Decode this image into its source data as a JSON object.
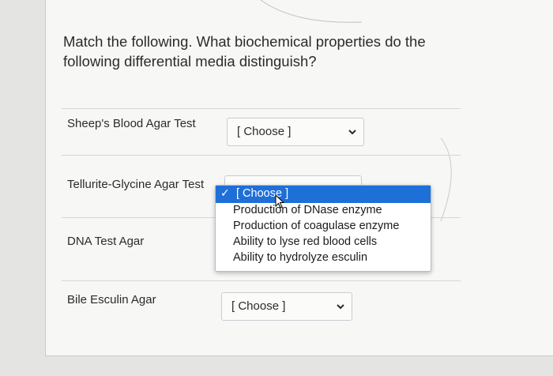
{
  "question": "Match the following. What biochemical properties do the following differential media distinguish?",
  "rows": [
    {
      "label": "Sheep's Blood Agar Test",
      "value": "[ Choose ]"
    },
    {
      "label": "Tellurite-Glycine Agar Test",
      "value": "[ Choose ]"
    },
    {
      "label": "DNA Test Agar",
      "value": ""
    },
    {
      "label": "Bile Esculin Agar",
      "value": "[ Choose ]"
    }
  ],
  "dropdown": {
    "selected": "[ Choose ]",
    "check_icon": "✓",
    "options": [
      "Production of DNase enzyme",
      "Production of coagulase enzyme",
      "Ability to lyse red blood cells",
      "Ability to hydrolyze esculin"
    ],
    "highlight_color": "#1f6fd9"
  }
}
